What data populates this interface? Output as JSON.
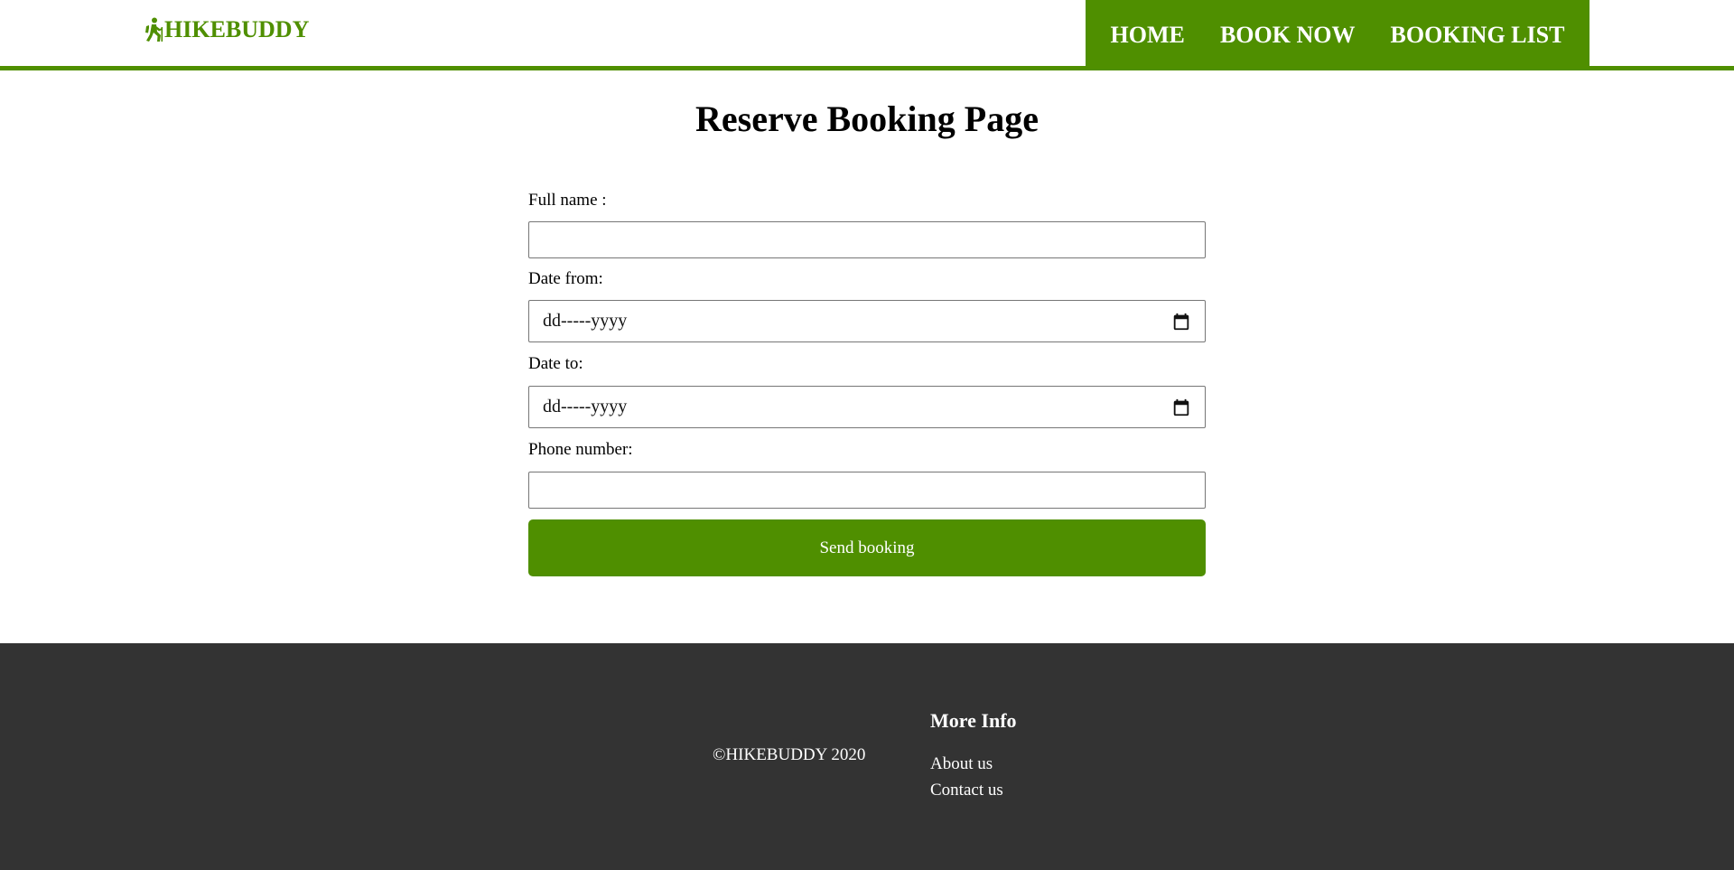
{
  "header": {
    "logo_text": "HIKEBUDDY",
    "logo_icon": "hiker-icon",
    "nav": [
      {
        "label": "HOME"
      },
      {
        "label": "BOOK NOW"
      },
      {
        "label": "BOOKING LIST"
      }
    ]
  },
  "main": {
    "title": "Reserve Booking Page",
    "form": {
      "full_name_label": "Full name :",
      "full_name_value": "",
      "date_from_label": "Date from:",
      "date_from_placeholder": "dd-----yyyy",
      "date_to_label": "Date to:",
      "date_to_placeholder": "dd-----yyyy",
      "phone_label": "Phone number:",
      "phone_value": "",
      "submit_label": "Send booking",
      "calendar_icon": "calendar-icon"
    }
  },
  "footer": {
    "copyright": "©HIKEBUDDY 2020",
    "more_info_title": "More Info",
    "links": [
      {
        "label": "About us"
      },
      {
        "label": "Contact us"
      }
    ]
  },
  "colors": {
    "brand": "#4f8f00",
    "footer_bg": "#333333"
  }
}
